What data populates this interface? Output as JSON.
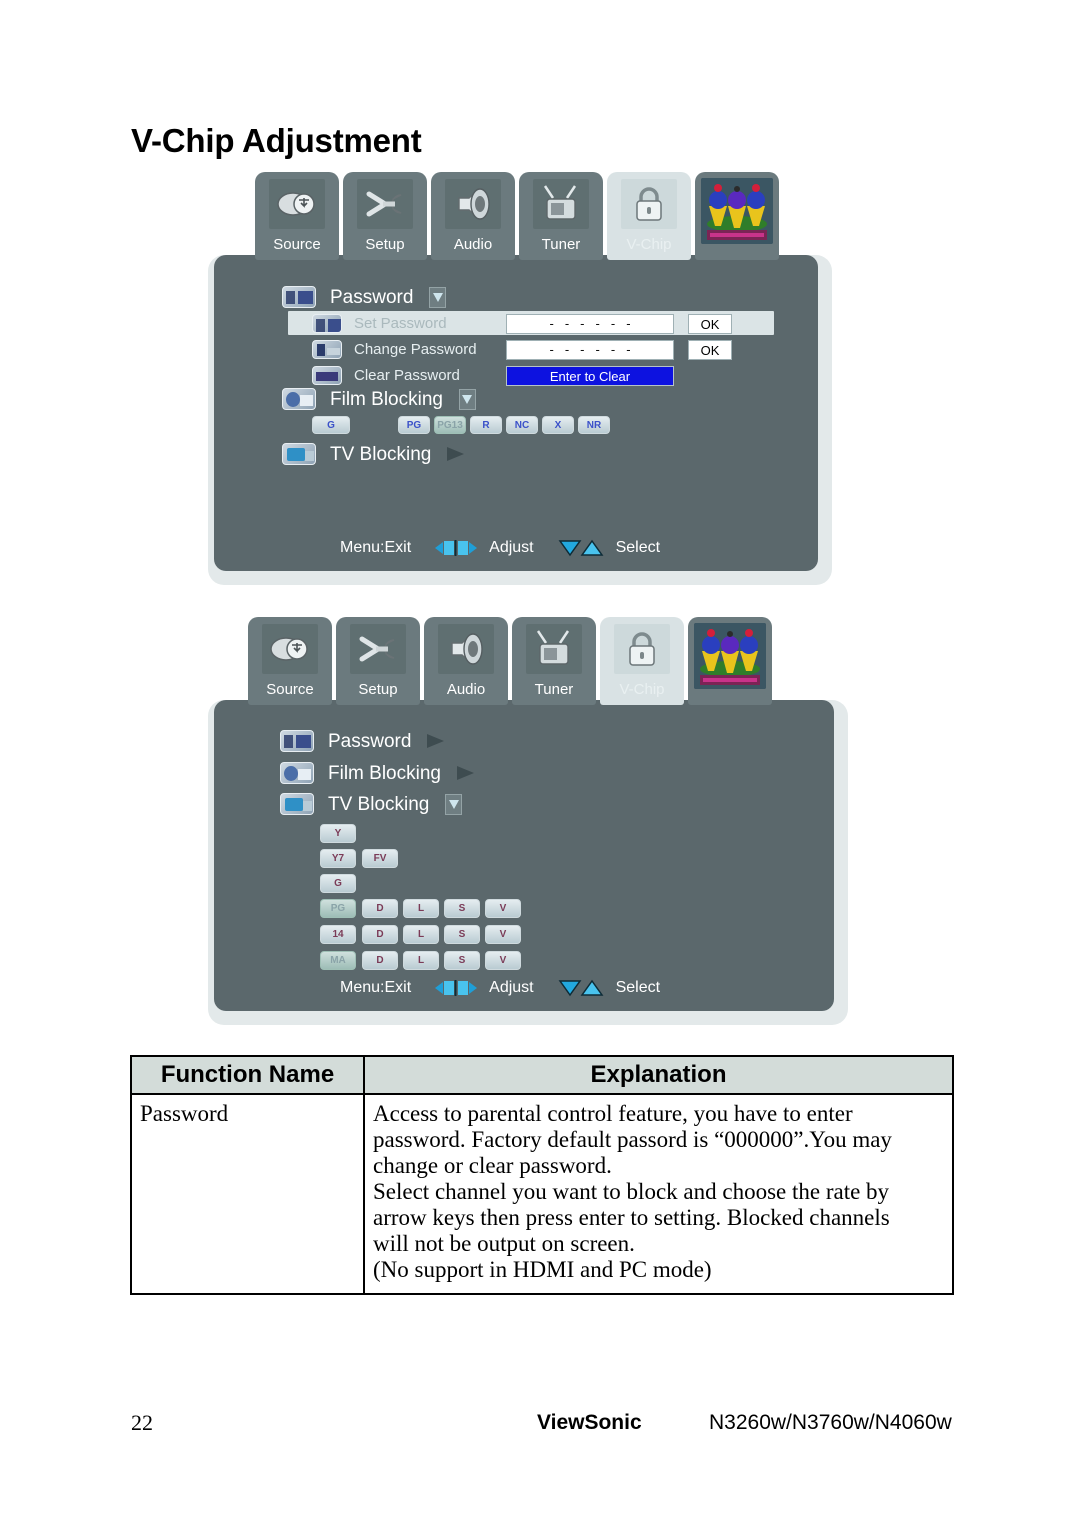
{
  "page": {
    "title": "V-Chip Adjustment",
    "number": "22",
    "brand": "ViewSonic",
    "models": "N3260w/N3760w/N4060w"
  },
  "osd_tabs": [
    {
      "label": "Source",
      "icon": "source-icon",
      "active": false
    },
    {
      "label": "Setup",
      "icon": "wrench-icon",
      "active": false
    },
    {
      "label": "Audio",
      "icon": "speaker-icon",
      "active": false
    },
    {
      "label": "Tuner",
      "icon": "tv-antenna-icon",
      "active": false
    },
    {
      "label": "V-Chip",
      "icon": "padlock-icon",
      "active": true
    },
    {
      "label": "",
      "icon": "viewsonic-birds-logo",
      "active": false
    }
  ],
  "osd1": {
    "items": [
      {
        "label": "Password",
        "icon": "password-icon",
        "marker": "chevron-down"
      },
      {
        "label": "Film Blocking",
        "icon": "film-icon",
        "marker": "chevron-down"
      },
      {
        "label": "TV Blocking",
        "icon": "tv-icon",
        "marker": "chevron-right"
      }
    ],
    "password_rows": [
      {
        "label": "Set Password",
        "icon": "set-password-icon",
        "value": "- - - - - -",
        "button": "OK",
        "highlighted": true
      },
      {
        "label": "Change Password",
        "icon": "change-password-icon",
        "value": "- - - - - -",
        "button": "OK",
        "highlighted": false
      },
      {
        "label": "Clear Password",
        "icon": "clear-password-icon",
        "value": "Enter to Clear",
        "button": "",
        "highlighted": false
      }
    ],
    "film_ratings": [
      {
        "label": "G",
        "selected": false
      },
      {
        "label": "PG",
        "selected": false
      },
      {
        "label": "PG13",
        "selected": true
      },
      {
        "label": "R",
        "selected": false
      },
      {
        "label": "NC",
        "selected": false
      },
      {
        "label": "X",
        "selected": false
      },
      {
        "label": "NR",
        "selected": false
      }
    ],
    "footer": {
      "exit": "Menu:Exit",
      "adjust": "Adjust",
      "select": "Select"
    }
  },
  "osd2": {
    "items": [
      {
        "label": "Password",
        "icon": "password-icon",
        "marker": "chevron-right"
      },
      {
        "label": "Film Blocking",
        "icon": "film-icon",
        "marker": "chevron-right"
      },
      {
        "label": "TV Blocking",
        "icon": "tv-icon",
        "marker": "chevron-down"
      }
    ],
    "tv_rating_rows": [
      {
        "rating": "Y",
        "rating_selected": false,
        "sub": []
      },
      {
        "rating": "Y7",
        "rating_selected": false,
        "sub": [
          "FV"
        ]
      },
      {
        "rating": "G",
        "rating_selected": false,
        "sub": []
      },
      {
        "rating": "PG",
        "rating_selected": true,
        "sub": [
          "D",
          "L",
          "S",
          "V"
        ]
      },
      {
        "rating": "14",
        "rating_selected": false,
        "sub": [
          "D",
          "L",
          "S",
          "V"
        ]
      },
      {
        "rating": "MA",
        "rating_selected": true,
        "sub": [
          "D",
          "L",
          "S",
          "V"
        ]
      }
    ],
    "footer": {
      "exit": "Menu:Exit",
      "adjust": "Adjust",
      "select": "Select"
    }
  },
  "table": {
    "headers": [
      "Function Name",
      "Explanation"
    ],
    "rows": [
      {
        "function_name": "Password",
        "explanation_lines": [
          "Access to parental control feature, you have to enter",
          "password. Factory default passord is “000000”.You may",
          "change or clear password.",
          "Select channel you want to block and choose the rate by",
          "arrow keys then press enter to setting. Blocked channels",
          "will not be output on screen.",
          "(No support in HDMI and PC mode)"
        ]
      }
    ]
  },
  "colors": {
    "osd_panel": "#5b686c",
    "osd_frame": "#e3e9ea",
    "tab_inactive": "#6b7a7e",
    "tab_active": "#d9e2e4",
    "highlight_row": "#dbe4e6",
    "clear_bar": "#0d12e0",
    "table_header": "#d3dcd9"
  }
}
